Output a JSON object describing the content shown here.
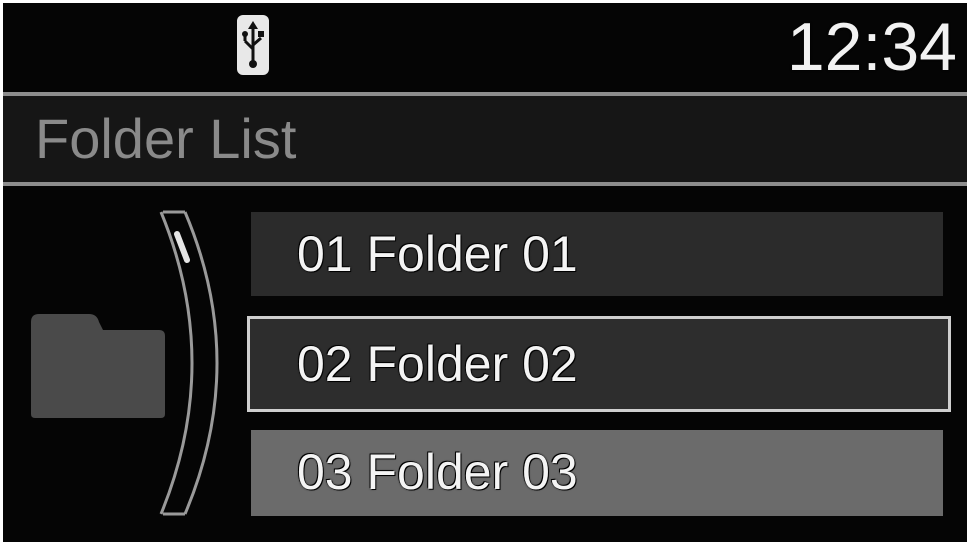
{
  "status_bar": {
    "source_icon": "usb-icon",
    "clock": "12:34"
  },
  "header": {
    "title": "Folder List"
  },
  "side": {
    "icon": "folder-icon",
    "scroll_position": 0.0
  },
  "list": {
    "items": [
      {
        "label": "01 Folder 01",
        "state": "normal"
      },
      {
        "label": "02 Folder 02",
        "state": "focused"
      },
      {
        "label": "03 Folder 03",
        "state": "highlighted"
      }
    ]
  },
  "colors": {
    "background": "#050505",
    "divider": "#8d8d8d",
    "text": "#f4f4f4",
    "title_text": "#8a8a8a",
    "focus_border": "#cfcfcf"
  }
}
